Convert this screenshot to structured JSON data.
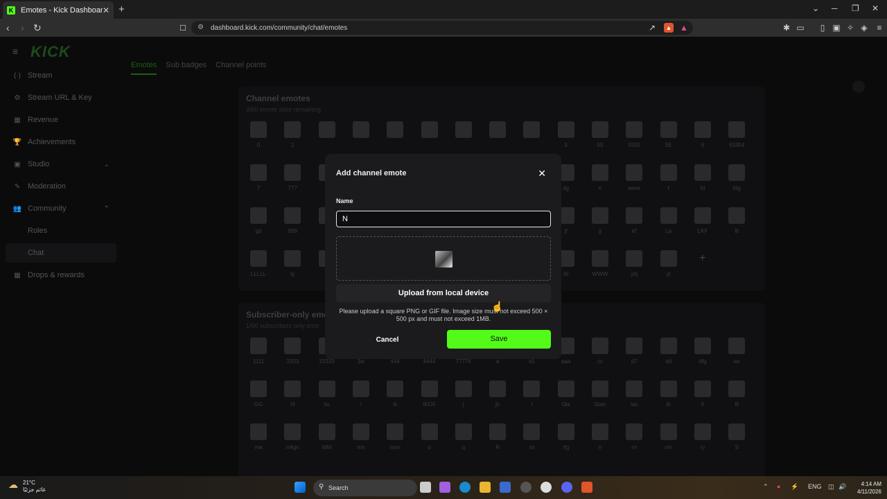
{
  "browser": {
    "tab_title": "Emotes - Kick Dashboard",
    "tab_favicon": "K",
    "url": "dashboard.kick.com/community/chat/emotes"
  },
  "sidebar": {
    "logo": "KICK",
    "items": [
      {
        "label": "Stream",
        "icon": "(·)"
      },
      {
        "label": "Stream URL & Key",
        "icon": "⚙"
      },
      {
        "label": "Revenue",
        "icon": "▦"
      },
      {
        "label": "Achievements",
        "icon": "🏆"
      },
      {
        "label": "Studio",
        "icon": "▣"
      },
      {
        "label": "Moderation",
        "icon": "✎"
      },
      {
        "label": "Community",
        "icon": "👥"
      },
      {
        "label": "Drops & rewards",
        "icon": "▦"
      }
    ],
    "sub_items": [
      "Roles",
      "Chat"
    ]
  },
  "tabs": [
    "Emotes",
    "Sub badges",
    "Channel points"
  ],
  "channel_emotes": {
    "title": "Channel emotes",
    "subtitle": "2/60 emote slots remaining",
    "labels": [
      "0",
      "1",
      "",
      "",
      "",
      "",
      "",
      "",
      "",
      "5",
      "55",
      "5555",
      "5E",
      "6",
      "63354",
      "7",
      "777",
      "",
      "",
      "",
      "",
      "",
      "",
      "",
      "dg",
      "e",
      "eese",
      "f",
      "fd",
      "fdg",
      "gd",
      "999",
      "",
      "",
      "",
      "",
      "",
      "",
      "",
      "jf",
      "jj",
      "kf",
      "La",
      "LKF",
      "lll",
      "LLLLL",
      "ly",
      "",
      "",
      "",
      "",
      "",
      "",
      "",
      "W",
      "WWW",
      "yhj",
      "yl",
      "+"
    ]
  },
  "subscriber_emotes": {
    "title": "Subscriber-only emotes",
    "subtitle": "1/60 subscribers only emo",
    "labels": [
      "1111",
      "3333",
      "33333",
      "3w",
      "444",
      "4444",
      "77776",
      "a",
      "a1",
      "aaa",
      "cc",
      "d7",
      "dd",
      "dfg",
      "ee",
      "GG",
      "hf",
      "hs",
      "i",
      "ik",
      "IKGF",
      "j",
      "jh",
      "l",
      "l3w",
      "l3we",
      "las",
      "lk",
      "ll",
      "lll",
      "ma",
      "mkgv",
      "MM",
      "mn",
      "nom",
      "o",
      "q",
      "R",
      "rd",
      "rfg",
      "rr",
      "rrr",
      "rrrr",
      "ry",
      "S"
    ]
  },
  "modal": {
    "title": "Add channel emote",
    "name_label": "Name",
    "name_value": "N",
    "upload_button": "Upload from local device",
    "help_text": "Please upload a square PNG or GIF file. Image size must not exceed 500 × 500 px and must not exceed 1MB.",
    "cancel": "Cancel",
    "save": "Save"
  },
  "taskbar": {
    "weather_temp": "21°C",
    "weather_desc": "غائم جزئيًا",
    "search": "Search",
    "lang": "ENG",
    "time": "4:14 AM",
    "date": "4/11/2026"
  },
  "colors": {
    "accent": "#53fc18",
    "modal_bg": "#1b1b1d"
  }
}
